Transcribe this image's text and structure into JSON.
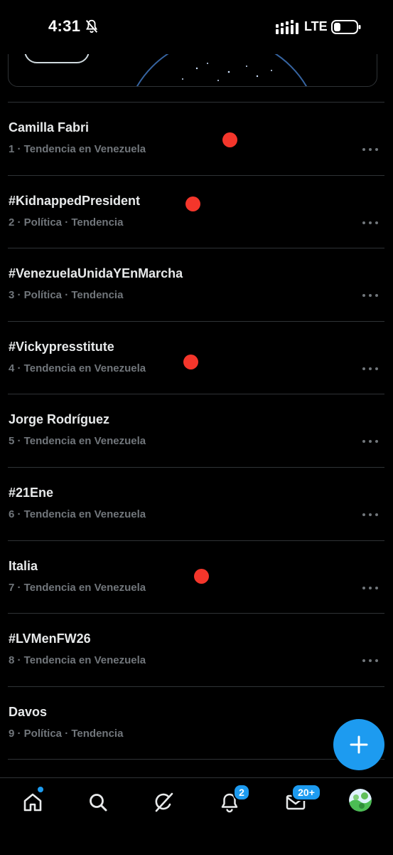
{
  "status_bar": {
    "time": "4:31",
    "network": "LTE"
  },
  "trends": [
    {
      "title": "Camilla Fabri",
      "meta": "1 · Tendencia en Venezuela"
    },
    {
      "title": "#KidnappedPresident",
      "meta": "2 · Política · Tendencia"
    },
    {
      "title": "#VenezuelaUnidaYEnMarcha",
      "meta": "3 · Política · Tendencia"
    },
    {
      "title": "#Vickypresstitute",
      "meta": "4 · Tendencia en Venezuela"
    },
    {
      "title": "Jorge Rodríguez",
      "meta": "5 · Tendencia en Venezuela"
    },
    {
      "title": "#21Ene",
      "meta": "6 · Tendencia en Venezuela"
    },
    {
      "title": "Italia",
      "meta": "7 · Tendencia en Venezuela"
    },
    {
      "title": "#LVMenFW26",
      "meta": "8 · Tendencia en Venezuela"
    },
    {
      "title": "Davos",
      "meta": "9 · Política · Tendencia"
    }
  ],
  "icons": {
    "bell": "bell-slash-icon",
    "signal": "signal-bars-icon",
    "battery": "battery-icon",
    "more": "more-horizontal-icon",
    "compose": "plus-icon",
    "nav": [
      "home-icon",
      "search-icon",
      "grok-icon",
      "notifications-icon",
      "messages-icon",
      "avatar"
    ]
  },
  "bottom_nav": {
    "notifications_badge": "2",
    "messages_badge": "20+"
  },
  "colors": {
    "background": "#000000",
    "text_primary": "#e7e9ea",
    "text_secondary": "#71767b",
    "accent": "#1d9bf0",
    "divider": "#2f3336",
    "annotation_dot": "#f4362b"
  }
}
